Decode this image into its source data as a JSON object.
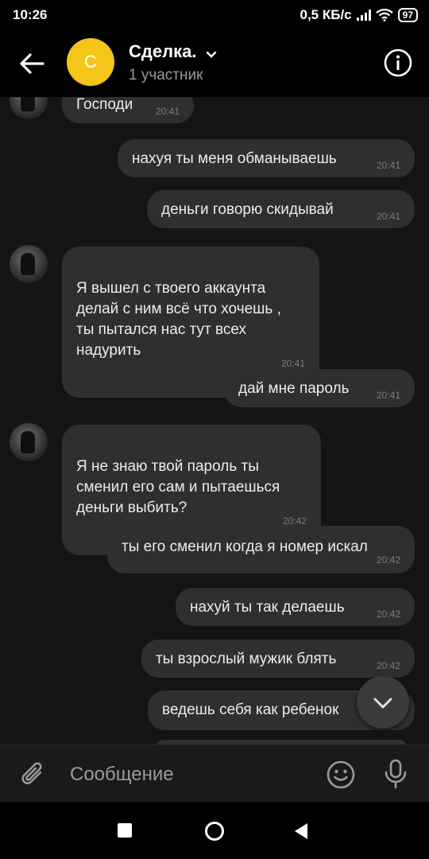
{
  "status": {
    "time": "10:26",
    "speed": "0,5 КБ/с",
    "battery": "97"
  },
  "header": {
    "avatar_letter": "С",
    "title": "Сделка.",
    "subtitle": "1 участник",
    "accent": "#f5c518"
  },
  "messages": [
    {
      "text": "Господи",
      "time": "20:41",
      "side": "in"
    },
    {
      "text": "нахуя ты меня обманываешь",
      "time": "20:41",
      "side": "out"
    },
    {
      "text": "деньги говорю скидывай",
      "time": "20:41",
      "side": "out"
    },
    {
      "text": "Я вышел с твоего аккаунта\nделай с ним всё что хочешь ,\nты пытался нас тут всех\nнадурить",
      "time": "20:41",
      "side": "in"
    },
    {
      "text": "дай мне пароль",
      "time": "20:41",
      "side": "out"
    },
    {
      "text": "Я не знаю твой пароль ты\nсменил его сам и пытаешься\nденьги выбить?",
      "time": "20:42",
      "side": "in"
    },
    {
      "text": "ты его сменил когда я номер искал",
      "time": "20:42",
      "side": "out"
    },
    {
      "text": "нахуй ты так делаешь",
      "time": "20:42",
      "side": "out"
    },
    {
      "text": "ты взрослый мужик блять",
      "time": "20:42",
      "side": "out"
    },
    {
      "text": "ведешь себя как ребенок",
      "time": "",
      "side": "out"
    }
  ],
  "composer": {
    "placeholder": "Сообщение"
  },
  "icons": {
    "back": "arrow-left-icon",
    "info": "info-icon",
    "chevron": "chevron-down-icon",
    "attach": "paperclip-icon",
    "emoji": "emoji-icon",
    "mic": "microphone-icon",
    "scroll_down": "chevron-down-icon"
  }
}
